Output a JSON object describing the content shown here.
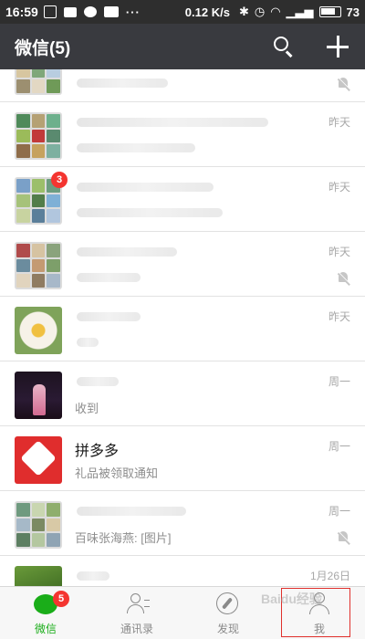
{
  "status_bar": {
    "time": "16:59",
    "dots": "···",
    "net_speed": "0.12 K/s",
    "battery": "73"
  },
  "header": {
    "title": "微信(5)",
    "search_icon": "search-icon",
    "add_icon": "plus-icon"
  },
  "chats": [
    {
      "name": "",
      "message": "",
      "time": "",
      "muted": true,
      "badge": ""
    },
    {
      "name": "",
      "message": "",
      "time": "昨天",
      "muted": false,
      "badge": ""
    },
    {
      "name": "",
      "message": "",
      "time": "昨天",
      "muted": false,
      "badge": "3"
    },
    {
      "name": "",
      "message": "",
      "time": "昨天",
      "muted": true,
      "badge": ""
    },
    {
      "name": "",
      "message": "",
      "time": "昨天",
      "muted": false,
      "badge": ""
    },
    {
      "name": "",
      "message": "收到",
      "time": "周一",
      "muted": false,
      "badge": ""
    },
    {
      "name": "拼多多",
      "message": "礼品被领取通知",
      "time": "周一",
      "muted": false,
      "badge": ""
    },
    {
      "name": "",
      "message": "百味张海燕: [图片]",
      "time": "周一",
      "muted": true,
      "badge": ""
    },
    {
      "name": "",
      "message": "",
      "time": "1月26日",
      "muted": false,
      "badge": ""
    }
  ],
  "tabs": [
    {
      "label": "微信",
      "badge": "5",
      "icon": "chat-icon"
    },
    {
      "label": "通讯录",
      "badge": "",
      "icon": "contacts-icon"
    },
    {
      "label": "发现",
      "badge": "",
      "icon": "compass-icon"
    },
    {
      "label": "我",
      "badge": "",
      "icon": "person-icon"
    }
  ],
  "watermark": "Baidu经验",
  "colors": {
    "header_bg": "#393a3f",
    "status_bg": "#2e2e2e",
    "active_green": "#1aad19",
    "badge_red": "#f43530"
  }
}
